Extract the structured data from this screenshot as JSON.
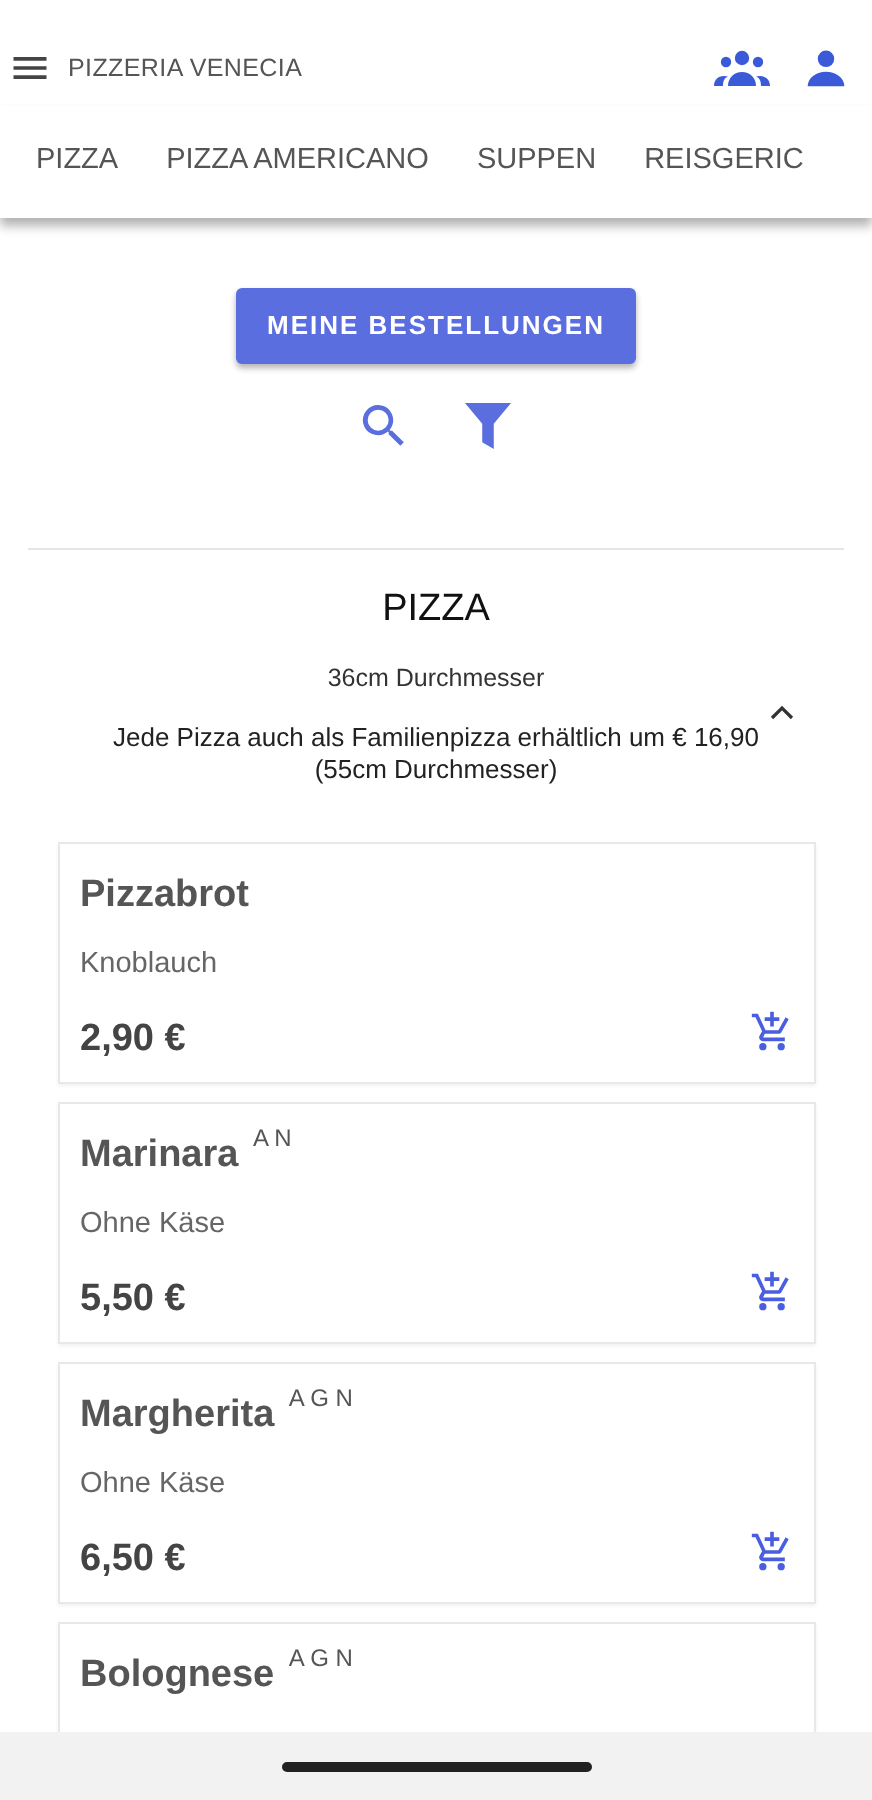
{
  "app_bar": {
    "title": "PIZZERIA VENECIA"
  },
  "tabs": [
    {
      "label": "PIZZA"
    },
    {
      "label": "PIZZA AMERICANO"
    },
    {
      "label": "SUPPEN"
    },
    {
      "label": "REISGERIC"
    }
  ],
  "orders_button": "MEINE BESTELLUNGEN",
  "section": {
    "title": "PIZZA",
    "subtitle": "36cm Durchmesser",
    "expanded": true,
    "note": "Jede Pizza auch als Familienpizza erhältlich um € 16,90 (55cm Durchmesser)"
  },
  "items": [
    {
      "name": "Pizzabrot",
      "description": "Knoblauch",
      "price": "2,90 €"
    },
    {
      "name": "Marinara $^{A N}$",
      "description": "Ohne Käse",
      "price": "5,50 €"
    },
    {
      "name": "Margherita $^{A G N}$",
      "description": "Ohne Käse",
      "price": "6,50 €"
    },
    {
      "name": "Bolognese $^{A G N}$"
    }
  ]
}
